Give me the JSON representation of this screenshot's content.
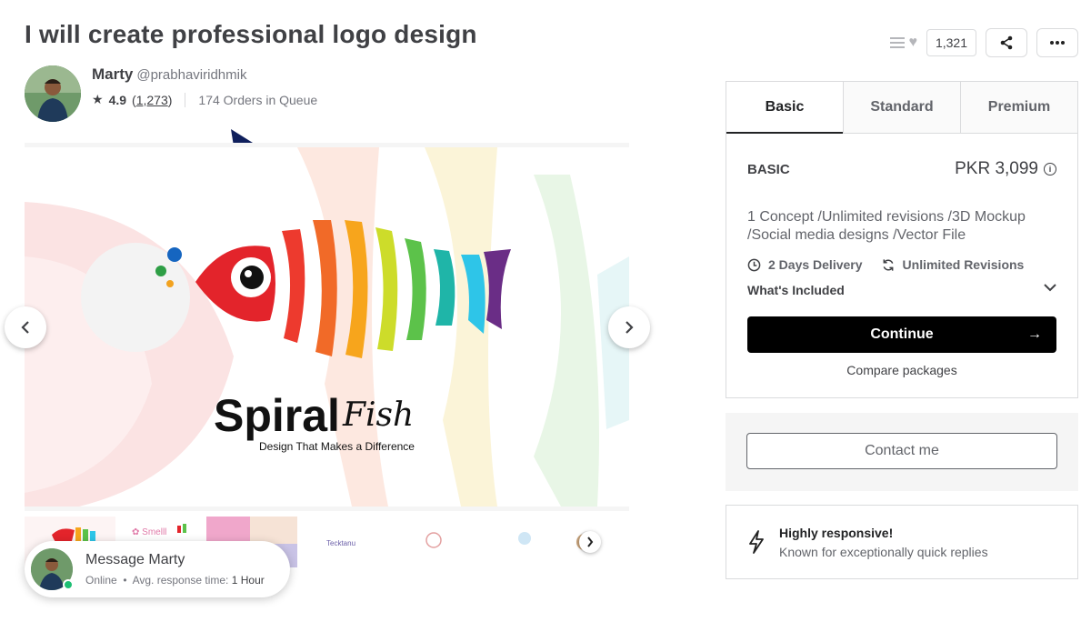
{
  "gig": {
    "title": "I will create professional logo design",
    "likes_count": "1,321"
  },
  "seller": {
    "name": "Marty",
    "handle": "@prabhaviridhmik",
    "rating": "4.9",
    "reviews": "1,273",
    "queue": "174 Orders in Queue"
  },
  "gallery": {
    "logo_main": "Spiral",
    "logo_script": "Fish",
    "logo_tagline": "Design That Makes a Difference"
  },
  "packages": {
    "tabs": [
      "Basic",
      "Standard",
      "Premium"
    ],
    "name": "BASIC",
    "price": "PKR 3,099",
    "description": "1 Concept /Unlimited revisions /3D Mockup /Social media designs /Vector File",
    "delivery": "2 Days Delivery",
    "revisions": "Unlimited Revisions",
    "whats_included": "What's Included",
    "continue_label": "Continue",
    "compare_label": "Compare packages"
  },
  "contact": {
    "label": "Contact me"
  },
  "response": {
    "title": "Highly responsive!",
    "subtitle": "Known for exceptionally quick replies"
  },
  "message_panel": {
    "title": "Message Marty",
    "status": "Online",
    "response_label": "Avg. response time:",
    "response_value": "1 Hour"
  },
  "colors": {
    "accent_green": "#1dbf73",
    "text_dark": "#404145",
    "annotation_arrow": "#0f1f5c"
  }
}
